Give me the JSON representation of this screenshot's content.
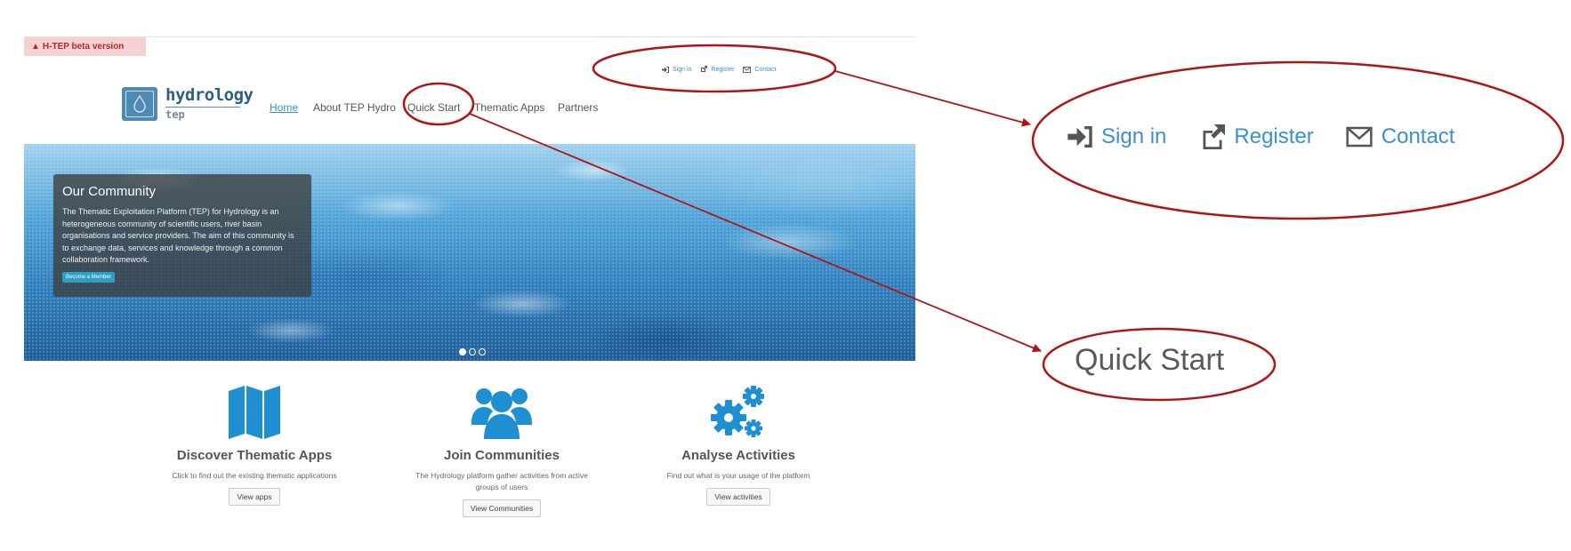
{
  "banner": {
    "icon": "warning-icon",
    "text": "H-TEP beta version"
  },
  "top_links": [
    {
      "icon": "sign-in-icon",
      "label": "Sign in"
    },
    {
      "icon": "external-link-icon",
      "label": "Register"
    },
    {
      "icon": "envelope-icon",
      "label": "Contact"
    }
  ],
  "brand": {
    "name": "hydrology",
    "sub": "tep"
  },
  "nav": [
    {
      "label": "Home",
      "active": true
    },
    {
      "label": "About TEP Hydro"
    },
    {
      "label": "Quick Start"
    },
    {
      "label": "Thematic Apps"
    },
    {
      "label": "Partners"
    }
  ],
  "hero": {
    "title": "Our Community",
    "text": "The Thematic Exploitation Platform (TEP) for Hydrology is an heterogeneous community of scientific users, river basin organisations and service providers. The aim of this community is to exchange data, services and knowledge through a common collaboration framework.",
    "button": "Become a Member",
    "slides": 3,
    "active_slide": 1
  },
  "features": [
    {
      "icon": "map-icon",
      "title": "Discover Thematic Apps",
      "text": "Click to find out the existing thematic applications",
      "button": "View apps"
    },
    {
      "icon": "users-icon",
      "title": "Join Communities",
      "text": "The Hydrology platform gather activities from active groups of users",
      "button": "View Communities"
    },
    {
      "icon": "gears-icon",
      "title": "Analyse Activities",
      "text": "Find out what is your usage of the platform",
      "button": "View activities"
    }
  ],
  "zoom": {
    "links": [
      {
        "icon": "sign-in-icon",
        "label": "Sign in"
      },
      {
        "icon": "external-link-icon",
        "label": "Register"
      },
      {
        "icon": "envelope-icon",
        "label": "Contact"
      }
    ],
    "quick_start": "Quick Start"
  },
  "colors": {
    "link": "#3b8fd3",
    "annotation": "#b01515",
    "beta_bg": "#f4d2d2",
    "icon_blue": "#1e8fd0"
  }
}
